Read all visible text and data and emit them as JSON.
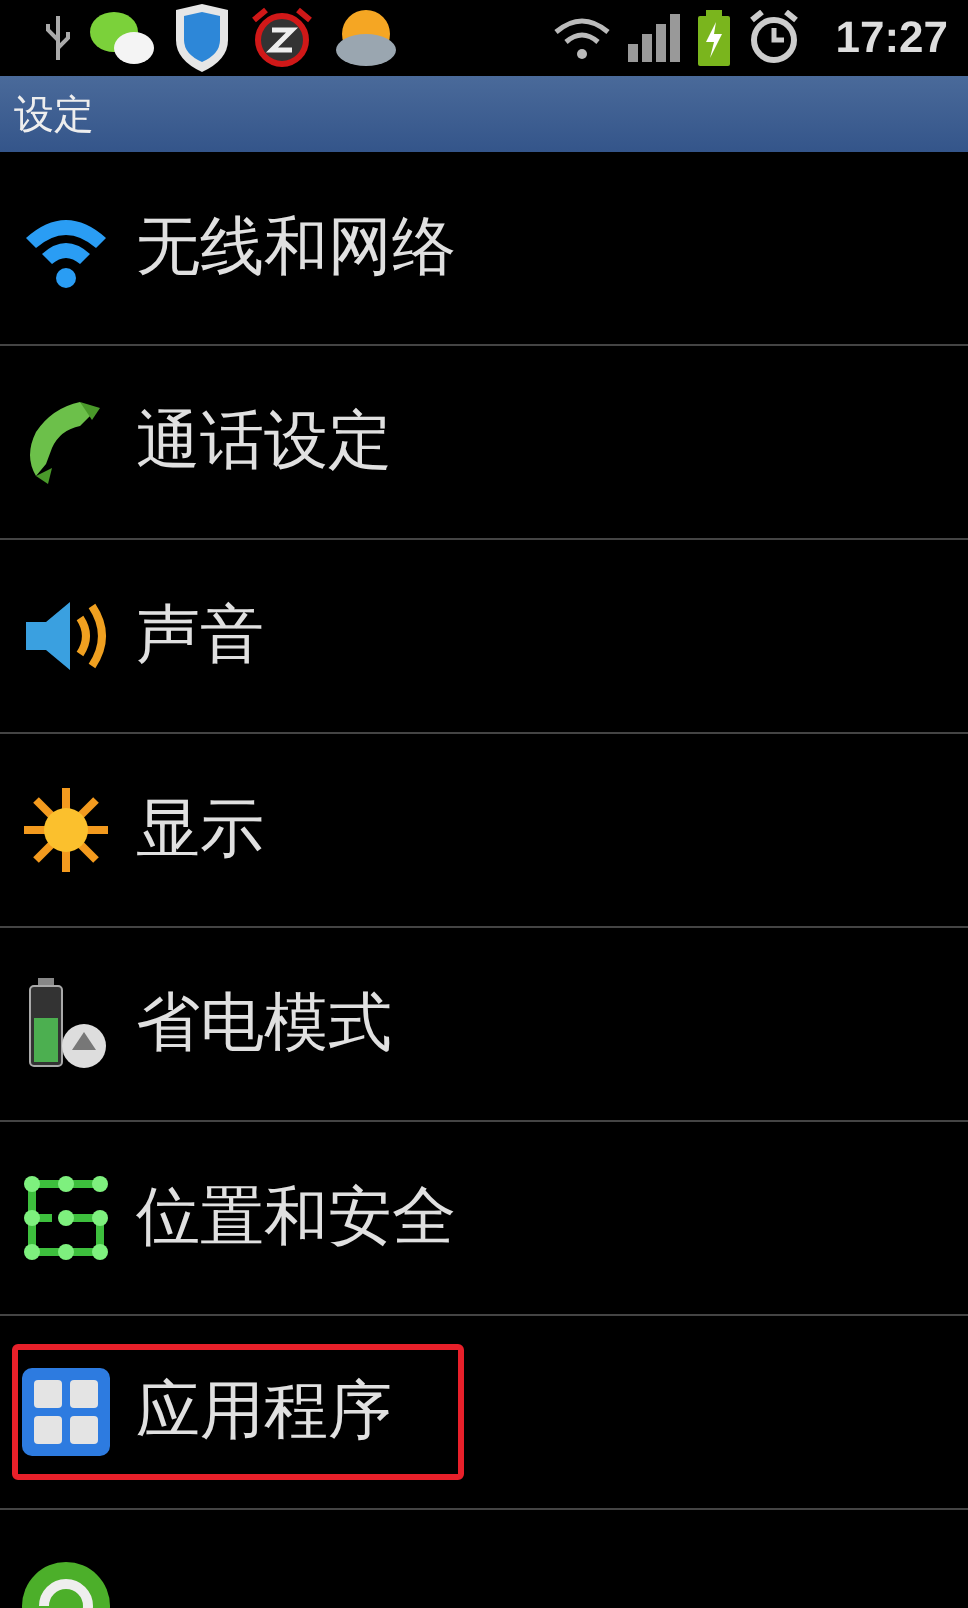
{
  "status_bar": {
    "time": "17:27"
  },
  "title_bar": {
    "title": "设定"
  },
  "items": [
    {
      "label": "无线和网络",
      "kind": "wireless",
      "highlighted": false
    },
    {
      "label": "通话设定",
      "kind": "call",
      "highlighted": false
    },
    {
      "label": "声音",
      "kind": "sound",
      "highlighted": false
    },
    {
      "label": "显示",
      "kind": "display",
      "highlighted": false
    },
    {
      "label": "省电模式",
      "kind": "power",
      "highlighted": false
    },
    {
      "label": "位置和安全",
      "kind": "location",
      "highlighted": false
    },
    {
      "label": "应用程序",
      "kind": "apps",
      "highlighted": true
    },
    {
      "kind": "sync",
      "highlighted": false
    }
  ]
}
